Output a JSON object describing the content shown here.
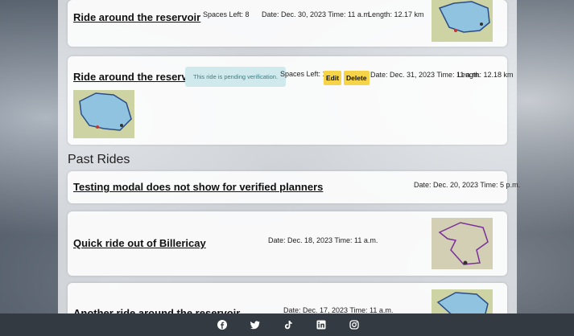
{
  "rides": [
    {
      "title": "Ride around the reservoir",
      "spaces": "Spaces Left: 8",
      "date": "Date: Dec. 30, 2023 Time: 11 a.m.",
      "length": "Length: 12.17 km"
    },
    {
      "title": "Ride around the reservoir",
      "pending": "This ride is pending verification.",
      "spaces": "Spaces Left: 10",
      "edit": "Edit",
      "delete": "Delete",
      "date": "Date: Dec. 31, 2023 Time: 11 a.m.",
      "length": "Length: 12.18 km"
    }
  ],
  "past_heading": "Past Rides",
  "past_rides": [
    {
      "title": "Testing modal does not show for verified planners",
      "date": "Date: Dec. 20, 2023 Time: 5 p.m."
    },
    {
      "title": "Quick ride out of Billericay",
      "date": "Date: Dec. 18, 2023 Time: 11 a.m."
    },
    {
      "title": "Another ride around the reservoir",
      "date": "Date: Dec. 17, 2023 Time: 11 a.m."
    }
  ],
  "footer_icons": [
    "facebook-icon",
    "twitter-icon",
    "tiktok-icon",
    "linkedin-icon",
    "instagram-icon"
  ],
  "colors": {
    "button": "#f6d44a",
    "pending_bg": "#cfe9ec",
    "footer": "#343a42"
  }
}
